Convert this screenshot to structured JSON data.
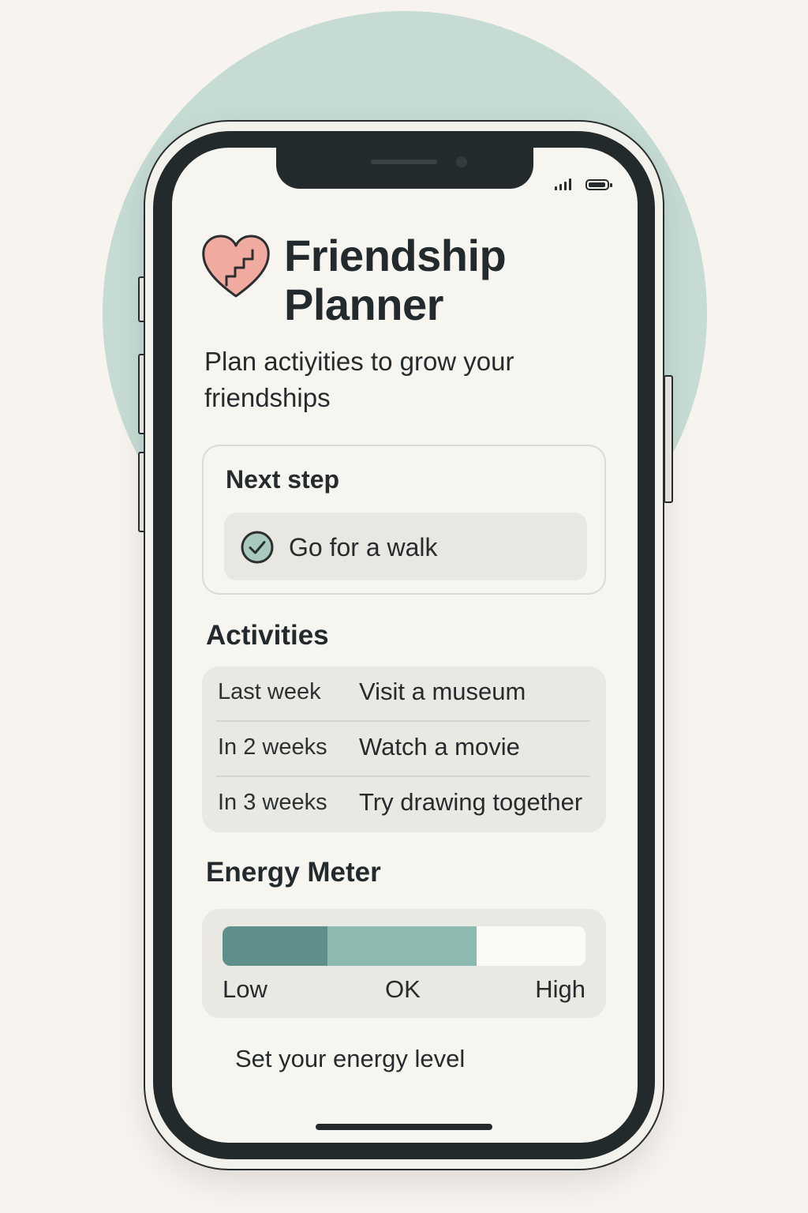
{
  "app": {
    "title": "Friendship Planner",
    "subtitle": "Plan actiyities to grow your friendships",
    "logo_icon": "heart-stairs-icon"
  },
  "status_bar": {
    "signal_icon": "signal-icon",
    "battery_icon": "battery-icon"
  },
  "next_step": {
    "title": "Next step",
    "item": {
      "label": "Go for a walk",
      "icon": "check-circle-icon",
      "checked": true
    }
  },
  "activities": {
    "title": "Activities",
    "items": [
      {
        "when": "Last week",
        "what": "Visit a museum"
      },
      {
        "when": "In 2 weeks",
        "what": "Watch a movie"
      },
      {
        "when": "In 3 weeks",
        "what": "Try drawing together"
      }
    ]
  },
  "energy": {
    "title": "Energy Meter",
    "labels": {
      "low": "Low",
      "ok": "OK",
      "high": "High"
    },
    "level": 0.7,
    "dark_segment": 0.29,
    "action_label": "Set your energy level"
  },
  "colors": {
    "accent": "#8dbab0",
    "accent_dark": "#5f8f8a",
    "heart": "#f0aaa0",
    "background_circle": "#c5dbd3",
    "phone_frame": "#232a2b"
  }
}
